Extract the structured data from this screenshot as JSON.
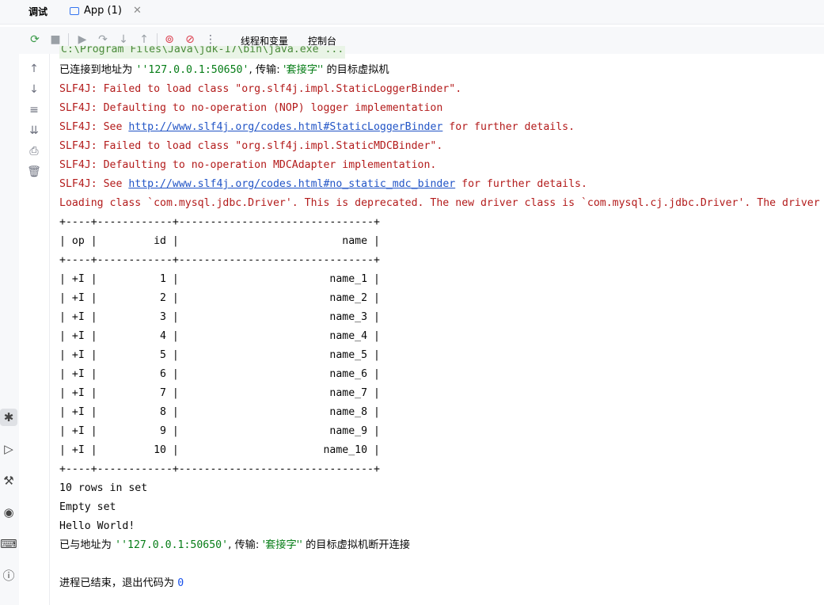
{
  "tabs": {
    "debug_label": "调试",
    "app_tab_label": "App (1)"
  },
  "toolbar": {
    "threads_label": "线程和变量",
    "console_label": "控制台"
  },
  "console": {
    "truncated_cmd": "C:\\Program Files\\Java\\jdk-17\\bin\\java.exe ...",
    "connected_prefix": "已连接到地址为 ",
    "connected_addr": "''127.0.0.1:50650'",
    "connected_mid": ", 传输: ",
    "connected_transport": "'套接字''",
    "connected_suffix": " 的目标虚拟机",
    "err1": "SLF4J: Failed to load class \"org.slf4j.impl.StaticLoggerBinder\".",
    "err2": "SLF4J: Defaulting to no-operation (NOP) logger implementation",
    "err3_prefix": "SLF4J: See ",
    "err3_link": "http://www.slf4j.org/codes.html#StaticLoggerBinder",
    "err3_suffix": " for further details.",
    "err4": "SLF4J: Failed to load class \"org.slf4j.impl.StaticMDCBinder\".",
    "err5": "SLF4J: Defaulting to no-operation MDCAdapter implementation.",
    "err6_prefix": "SLF4J: See ",
    "err6_link": "http://www.slf4j.org/codes.html#no_static_mdc_binder",
    "err6_suffix": " for further details.",
    "err7": "Loading class `com.mysql.jdbc.Driver'. This is deprecated. The new driver class is `com.mysql.cj.jdbc.Driver'. The driver",
    "table_border": "+----+------------+-------------------------------+",
    "table_header": "| op |         id |                          name |",
    "table_rows": [
      "| +I |          1 |                        name_1 |",
      "| +I |          2 |                        name_2 |",
      "| +I |          3 |                        name_3 |",
      "| +I |          4 |                        name_4 |",
      "| +I |          5 |                        name_5 |",
      "| +I |          6 |                        name_6 |",
      "| +I |          7 |                        name_7 |",
      "| +I |          8 |                        name_8 |",
      "| +I |          9 |                        name_9 |",
      "| +I |         10 |                       name_10 |"
    ],
    "rows_in_set": "10 rows in set",
    "empty_set": "Empty set",
    "hello": "Hello World!",
    "disconnected_prefix": "已与地址为 ",
    "disconnected_addr": "''127.0.0.1:50650'",
    "disconnected_mid": ", 传输: ",
    "disconnected_transport": "'套接字''",
    "disconnected_suffix": " 的目标虚拟机断开连接",
    "exit_prefix": "进程已结束，退出代码为 ",
    "exit_code": "0"
  }
}
